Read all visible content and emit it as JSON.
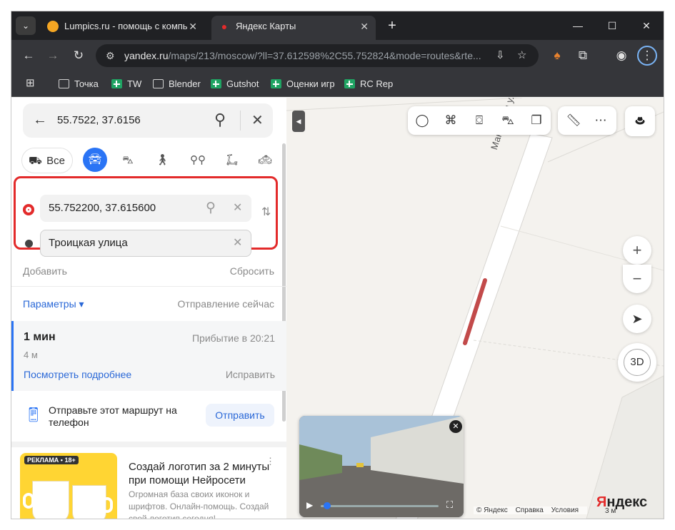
{
  "browser": {
    "tabs": [
      {
        "title": "Lumpics.ru - помощь с компь",
        "active": false,
        "favicon_color": "#f5a623"
      },
      {
        "title": "Яндекс Карты",
        "active": true,
        "favicon_color": "#e32b2b"
      }
    ],
    "url_host": "yandex.ru",
    "url_path": "/maps/213/moscow/?ll=37.612598%2C55.752824&mode=routes&rte...",
    "bookmarks": [
      {
        "label": "Точка",
        "icon": "folder-icon"
      },
      {
        "label": "TW",
        "icon": "sheet-icon"
      },
      {
        "label": "Blender",
        "icon": "folder-icon"
      },
      {
        "label": "Gutshot",
        "icon": "sheet-icon"
      },
      {
        "label": "Оценки игр",
        "icon": "sheet-icon"
      },
      {
        "label": "RC Rep",
        "icon": "sheet-icon"
      }
    ]
  },
  "panel": {
    "search_value": "55.7522, 37.6156",
    "modes": {
      "all_label": "Все",
      "selected": "car"
    },
    "route_from": "55.752200, 37.615600",
    "route_to": "Троицкая улица",
    "add_label": "Добавить",
    "reset_label": "Сбросить",
    "params_label": "Параметры ▾",
    "departure_label": "Отправление сейчас",
    "route": {
      "time": "1 мин",
      "arrival": "Прибытие в 20:21",
      "distance": "4 м",
      "more_label": "Посмотреть подробнее",
      "fix_label": "Исправить"
    },
    "send": {
      "text": "Отправьте этот маршрут на телефон",
      "button": "Отправить"
    },
    "ad": {
      "badge": "РЕКЛАМА • 18+",
      "title": "Создай логотип за 2 минуты при помощи Нейросети",
      "desc": "Огромная база своих иконок и шрифтов. Онлайн-помощь. Создай свой логотип сегодня!"
    }
  },
  "map": {
    "street": "Манежная ул.",
    "btn_3d": "3D",
    "logo": "Яндекс",
    "attribution": [
      "© Яндекс",
      "Справка",
      "Условия"
    ],
    "scale": "3 м",
    "highlight_color": "#e32b2b",
    "accent_color": "#2a74f5"
  }
}
